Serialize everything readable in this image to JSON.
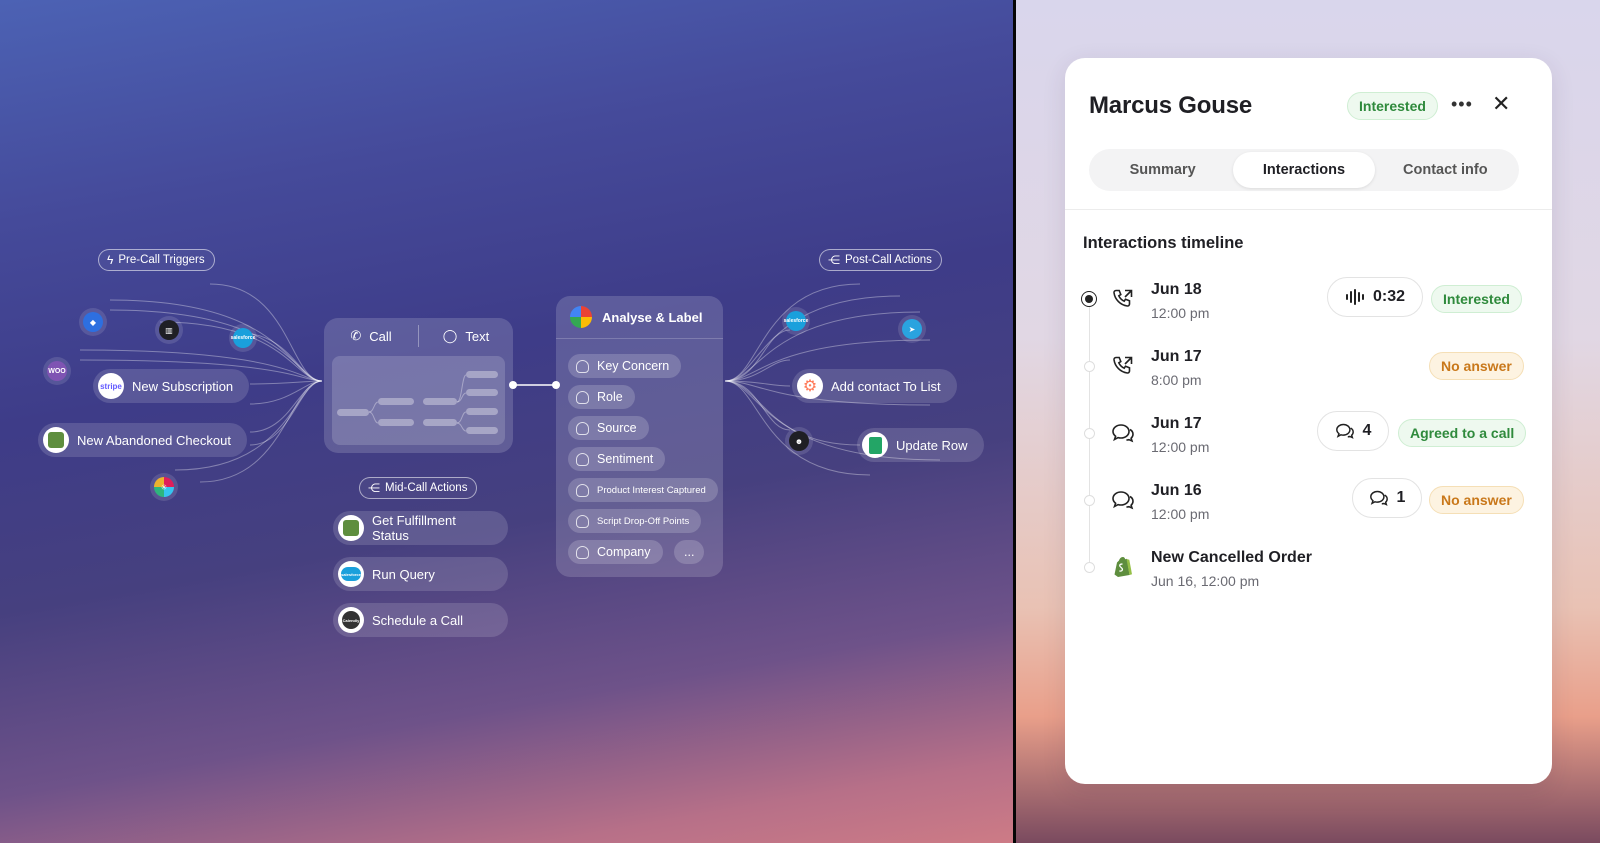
{
  "workflow": {
    "pre_call_label": "Pre-Call Triggers",
    "mid_call_label": "Mid-Call Actions",
    "post_call_label": "Post-Call Actions",
    "triggers": [
      {
        "label": "New Subscription",
        "logo": "stripe"
      },
      {
        "label": "New Abandoned Checkout",
        "logo": "shopify"
      }
    ],
    "channel_tabs": {
      "call": "Call",
      "text": "Text"
    },
    "mid_call_actions": [
      {
        "label": "Get Fulfillment Status",
        "logo": "shopify"
      },
      {
        "label": "Run Query",
        "logo": "salesforce"
      },
      {
        "label": "Schedule a Call",
        "logo": "calendly"
      }
    ],
    "analyse": {
      "title": "Analyse & Label",
      "labels": [
        "Key Concern",
        "Role",
        "Source",
        "Sentiment",
        "Product Interest Captured",
        "Script Drop-Off Points",
        "Company"
      ],
      "more": "..."
    },
    "post_call_actions": [
      {
        "label": "Add contact To List",
        "logo": "hubspot"
      },
      {
        "label": "Update Row",
        "logo": "google-sheets"
      }
    ],
    "logo_texts": {
      "stripe": "stripe",
      "woo": "WOO",
      "salesforce": "salesforce",
      "calendly": "Calendly"
    }
  },
  "contact": {
    "name": "Marcus Gouse",
    "status": "Interested",
    "more_icon": "more-icon",
    "close_icon": "close-icon",
    "tabs": [
      {
        "label": "Summary",
        "active": false
      },
      {
        "label": "Interactions",
        "active": true
      },
      {
        "label": "Contact info",
        "active": false
      }
    ],
    "timeline_title": "Interactions timeline",
    "timeline": [
      {
        "icon": "phone-icon",
        "title": "Jun 18",
        "time": "12:00 pm",
        "chip": "0:32",
        "chip_icon": "audio-wave-icon",
        "status": "Interested",
        "status_color": "green"
      },
      {
        "icon": "phone-icon",
        "title": "Jun 17",
        "time": "8:00 pm",
        "status": "No answer",
        "status_color": "amber"
      },
      {
        "icon": "chat-icon",
        "title": "Jun 17",
        "time": "12:00 pm",
        "chip": "4",
        "chip_icon": "chat-icon",
        "status": "Agreed to a call",
        "status_color": "green"
      },
      {
        "icon": "chat-icon",
        "title": "Jun 16",
        "time": "12:00 pm",
        "chip": "1",
        "chip_icon": "chat-icon",
        "status": "No answer",
        "status_color": "amber"
      },
      {
        "icon": "shopify-icon",
        "title": "New Cancelled Order",
        "time": "Jun 16, 12:00 pm"
      }
    ]
  }
}
